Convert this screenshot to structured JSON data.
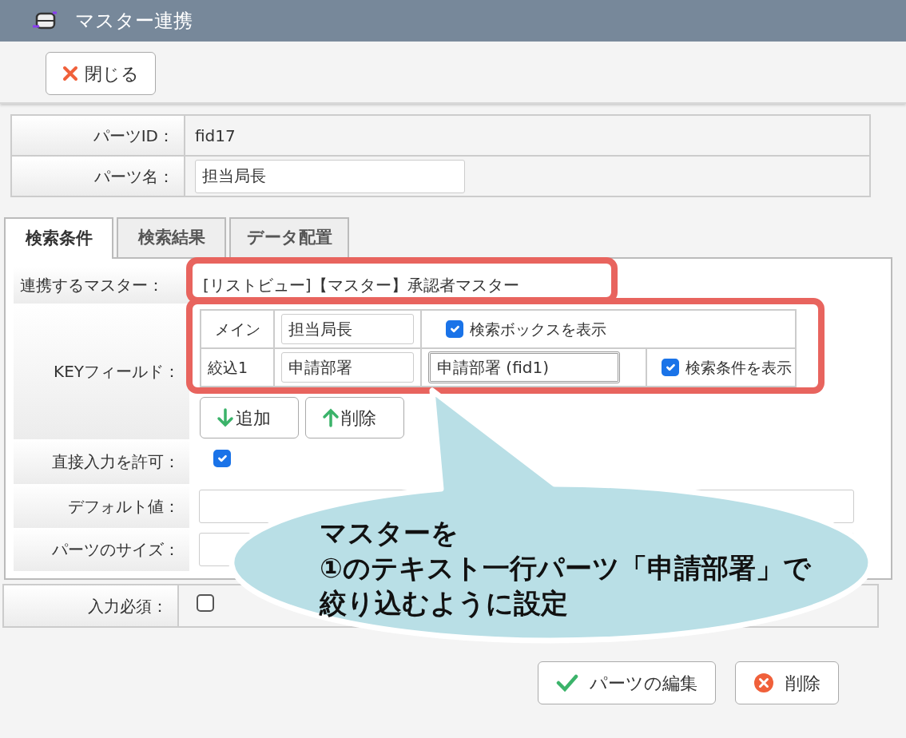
{
  "window": {
    "title": "マスター連携"
  },
  "toolbar": {
    "close_button": "閉じる"
  },
  "properties": [
    {
      "label": "パーツID：",
      "value": "fid17",
      "kind": "text"
    },
    {
      "label": "パーツ名：",
      "value": "担当局長",
      "kind": "input"
    }
  ],
  "tabs": [
    {
      "label": "検索条件",
      "selected": true
    },
    {
      "label": "検索結果",
      "selected": false
    },
    {
      "label": "データ配置",
      "selected": false
    }
  ],
  "search_conditions": {
    "master": {
      "label": "連携するマスター：",
      "value": "[リストビュー]【マスター】承認者マスター",
      "highlighted": true
    },
    "key_fields": {
      "label": "KEYフィールド：",
      "highlighted": true,
      "rows": [
        {
          "name": "メイン",
          "field": "担当局長",
          "checkbox_label": "検索ボックスを表示",
          "checked": true
        },
        {
          "name": "絞込1",
          "field": "申請部署",
          "filter": "申請部署 (fid1)",
          "checkbox_label": "検索条件を表示",
          "checked": true
        }
      ],
      "add_button": "追加",
      "remove_button": "削除"
    },
    "allow_direct_input": {
      "label": "直接入力を許可：",
      "checked": true
    },
    "default_value": {
      "label": "デフォルト値："
    },
    "part_size": {
      "label": "パーツのサイズ："
    }
  },
  "required": {
    "label": "入力必須：",
    "checked": false
  },
  "footer_buttons": [
    {
      "label": "パーツの編集",
      "kind": "edit"
    },
    {
      "label": "削除",
      "kind": "delete"
    }
  ],
  "callout": {
    "lines": [
      "マスターを",
      "①のテキスト一行パーツ「申請部署」で",
      "絞り込むように設定"
    ]
  }
}
